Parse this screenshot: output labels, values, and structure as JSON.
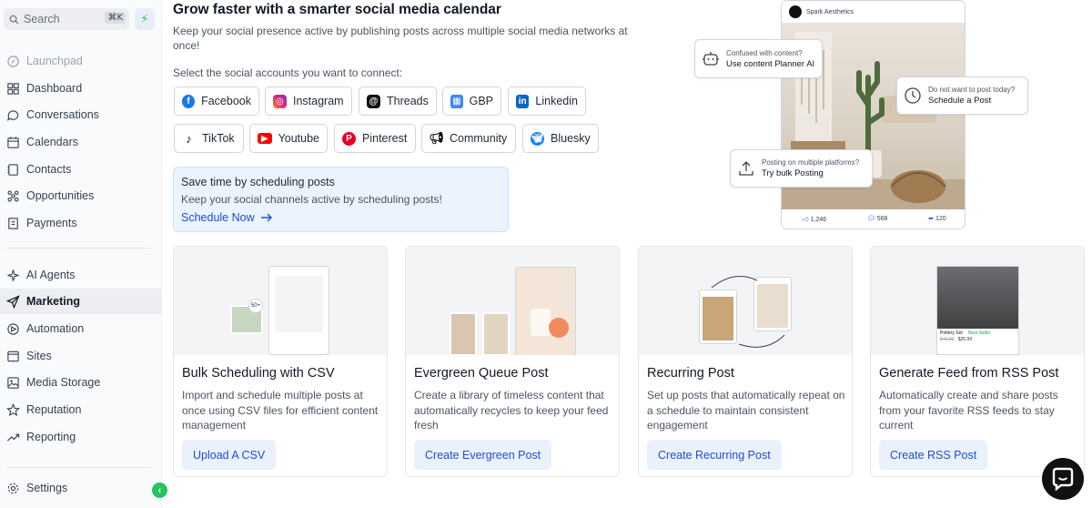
{
  "sidebar": {
    "search_placeholder": "Search",
    "search_shortcut": "⌘K",
    "items": [
      {
        "label": "Launchpad",
        "icon": "launchpad-icon"
      },
      {
        "label": "Dashboard",
        "icon": "dashboard-icon"
      },
      {
        "label": "Conversations",
        "icon": "chat-bubble-icon"
      },
      {
        "label": "Calendars",
        "icon": "calendar-icon"
      },
      {
        "label": "Contacts",
        "icon": "contacts-icon"
      },
      {
        "label": "Opportunities",
        "icon": "opportunities-icon"
      },
      {
        "label": "Payments",
        "icon": "payments-icon"
      },
      {
        "label": "AI Agents",
        "icon": "sparkle-icon"
      },
      {
        "label": "Marketing",
        "icon": "send-icon"
      },
      {
        "label": "Automation",
        "icon": "automation-icon"
      },
      {
        "label": "Sites",
        "icon": "sites-icon"
      },
      {
        "label": "Media Storage",
        "icon": "image-icon"
      },
      {
        "label": "Reputation",
        "icon": "star-icon"
      },
      {
        "label": "Reporting",
        "icon": "trend-icon"
      },
      {
        "label": "Settings",
        "icon": "gear-icon"
      }
    ]
  },
  "hero": {
    "title": "Grow faster with a smarter social media calendar",
    "subtitle": "Keep your social presence active by publishing posts across multiple social media networks at once!",
    "select_label": "Select the social accounts you want to connect:",
    "accounts": [
      {
        "label": "Facebook",
        "color": "#1877f2"
      },
      {
        "label": "Instagram",
        "color": "#e1306c"
      },
      {
        "label": "Threads",
        "color": "#111111"
      },
      {
        "label": "GBP",
        "color": "#4285f4"
      },
      {
        "label": "Linkedin",
        "color": "#0a66c2"
      },
      {
        "label": "TikTok",
        "color": "#111111"
      },
      {
        "label": "Youtube",
        "color": "#ff0000"
      },
      {
        "label": "Pinterest",
        "color": "#e60023"
      },
      {
        "label": "Community",
        "color": "#111111"
      },
      {
        "label": "Bluesky",
        "color": "#1185fe"
      }
    ],
    "promo": {
      "title": "Save time by scheduling posts",
      "desc": "Keep your social channels active by scheduling posts!",
      "link": "Schedule Now"
    }
  },
  "preview": {
    "account_name": "Spark Aesthetics",
    "likes": "1,246",
    "comments": "568",
    "shares": "120",
    "callouts": [
      {
        "small": "Confused with content?",
        "big": "Use content Planner AI"
      },
      {
        "small": "Do not want to post today?",
        "big": "Schedule a Post"
      },
      {
        "small": "Posting on multiple platforms?",
        "big": "Try bulk Posting"
      }
    ]
  },
  "cards": [
    {
      "title": "Bulk Scheduling with CSV",
      "desc": "Import and schedule multiple posts at once using CSV files for efficient content management",
      "button": "Upload A CSV"
    },
    {
      "title": "Evergreen Queue Post",
      "desc": "Create a library of timeless content that automatically recycles to keep your feed fresh",
      "button": "Create Evergreen Post"
    },
    {
      "title": "Recurring Post",
      "desc": "Set up posts that automatically repeat on a schedule to maintain consistent engagement",
      "button": "Create Recurring Post"
    },
    {
      "title": "Generate Feed from RSS Post",
      "desc": "Automatically create and share posts from your favorite RSS feeds to stay current",
      "button": "Create RSS Post"
    }
  ],
  "card_art": {
    "csv_badge": "50+",
    "rss_product": "Pottery Set",
    "rss_badge": "Best Seller",
    "rss_old_price": "$49.99",
    "rss_price": "$25.99"
  },
  "colors": {
    "accent": "#1d4ed8",
    "active_bg": "#eceef1",
    "promo_bg": "#eaf3fe"
  }
}
